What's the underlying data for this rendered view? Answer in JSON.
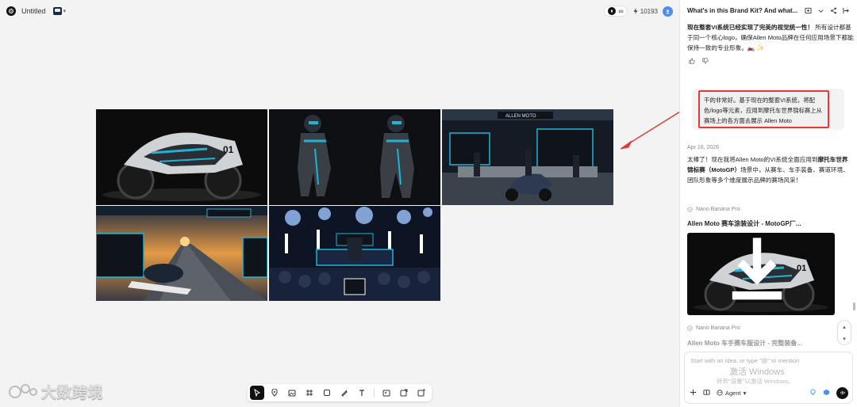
{
  "topbar": {
    "title": "Untitled",
    "infinity": "∞",
    "credits": "10193",
    "icons": [
      "app-logo-icon",
      "project-icon",
      "chevron-down-icon",
      "rocket-icon",
      "lightning-icon",
      "avatar-icon"
    ]
  },
  "canvas": {
    "images": [
      "motorcycle-livery",
      "rider-suits",
      "garage-booth",
      "race-track-sunset",
      "podium-celebration"
    ]
  },
  "toolbar": {
    "tools": [
      "select-tool",
      "marker-tool",
      "image-gen-tool",
      "frame-tool",
      "shape-tool",
      "pen-tool",
      "text-tool",
      "upload-image-tool",
      "edit-image-tool",
      "video-tool"
    ]
  },
  "watermark": {
    "text": "大数跨境"
  },
  "panel": {
    "header_title": "What's in this Brand Kit? And what...",
    "intro_bold": "现在整套VI系统已经实现了完美的视觉统一性！",
    "intro_text": "所有设计都基于同一个核心logo，确保Allen Moto品牌在任何应用场景下都能保持一致的专业形象。🏍️ ✨",
    "user_message": "干的非常好。基于现在的整套VI系统，将配色/logo等元素，应用到摩托车世界锦标赛上从赛场上的各方面去展示 Allen Moto",
    "date": "Apr 16, 2026",
    "reply_lead": "太棒了！现在我将Allen Moto的VI系统全面应用到",
    "reply_bold": "摩托车世界锦标赛（MotoGP）",
    "reply_tail": "场景中，从赛车、车手装备、赛道环境、团队形象等多个维度展示品牌的赛场风采！",
    "model_tag_1": "Nano Banana Pro",
    "card_title_1": "Allen Moto 赛车涂装设计 - MotoGP厂...",
    "model_tag_2": "Nano Banana Pro",
    "card_title_2": "Allen Moto 车手赛车服设计 - 完整装备...",
    "composer_placeholder": "Start with an idea, or type \"@\" to mention",
    "win_watermark_1": "激活 Windows",
    "win_watermark_2": "转到\"设置\"以激活 Windows。",
    "agent_label": "Agent"
  },
  "colors": {
    "annotation_red": "#e23a3a",
    "accent_teal": "#1fb3d6",
    "avatar_blue": "#4a8ef0"
  }
}
